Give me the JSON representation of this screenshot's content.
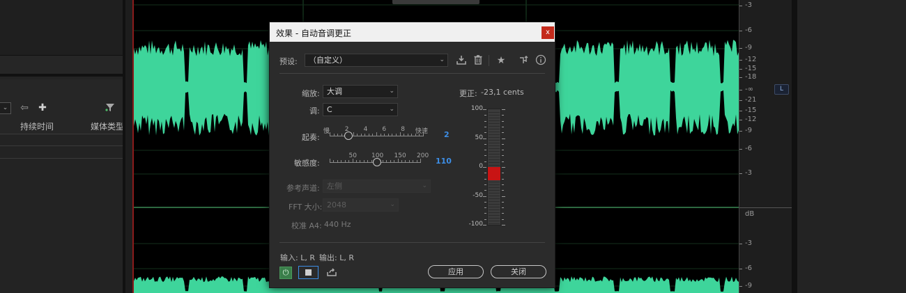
{
  "background_panel": {
    "columns": {
      "duration": "持续时间",
      "media_type": "媒体类型"
    },
    "select_arrow": "⌄",
    "icons": [
      "arrow-left-icon",
      "add-icon",
      "filter-icon"
    ]
  },
  "ruler": {
    "top_labels": [
      "-3",
      "-6",
      "-9",
      "-12",
      "-15",
      "-18",
      "-∞",
      "-21",
      "-15",
      "-12",
      "-9",
      "-6",
      "-3"
    ],
    "unit": "dB",
    "bottom_labels": [
      "-3",
      "-6",
      "-9"
    ],
    "channel_badge": "L"
  },
  "dialog": {
    "title": "效果 - 自动音调更正",
    "close_label": "x",
    "preset": {
      "label": "预设:",
      "value": "（自定义）"
    },
    "toolbar_icons": [
      "save-preset-icon",
      "delete-preset-icon",
      "favorite-icon",
      "routing-icon",
      "info-icon"
    ],
    "scale": {
      "label": "缩放:",
      "value": "大调"
    },
    "key": {
      "label": "调:",
      "value": "C"
    },
    "attack": {
      "label": "起奏:",
      "min_label": "慢",
      "max_label": "快速",
      "tick_labels": [
        "2",
        "4",
        "6",
        "8"
      ],
      "value": "2",
      "position_fraction": 0.2
    },
    "sensitivity": {
      "label": "敏感度:",
      "tick_labels": [
        "50",
        "100",
        "150",
        "200"
      ],
      "value": "110",
      "position_fraction": 0.52
    },
    "reference_channel": {
      "label": "参考声道:",
      "value": "左侧"
    },
    "fft_size": {
      "label": "FFT 大小:",
      "value": "2048"
    },
    "calibration": {
      "label": "校准 A4:",
      "value": "440 Hz"
    },
    "correction": {
      "label": "更正:",
      "value": "-23,1 cents",
      "scale_labels": [
        "100",
        "50",
        "0",
        "-50",
        "-100"
      ],
      "range": [
        -100,
        100
      ],
      "band": [
        -23.1,
        0
      ]
    },
    "io": {
      "input": "输入: L, R",
      "output": "输出: L, R"
    },
    "apply_label": "应用",
    "close_button_label": "关闭"
  },
  "colors": {
    "waveform": "#3ed59b",
    "meter_fill": "#c81414",
    "accent_blue": "#3d8ee6",
    "power_green": "#3a7e4a"
  }
}
